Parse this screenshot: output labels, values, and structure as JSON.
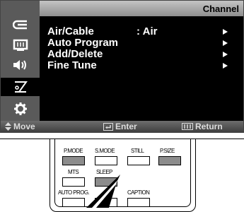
{
  "osd": {
    "title": "Channel",
    "sidebar_icons": [
      "input-icon",
      "picture-icon",
      "sound-icon",
      "channel-antenna-icon",
      "setup-gear-icon"
    ],
    "selected_icon_index": 3,
    "menu": [
      {
        "label": "Air/Cable",
        "value": ": Air",
        "has_arrow": true,
        "selected": true
      },
      {
        "label": "Auto Program",
        "value": "",
        "has_arrow": true,
        "selected": false
      },
      {
        "label": "Add/Delete",
        "value": "",
        "has_arrow": true,
        "selected": false
      },
      {
        "label": "Fine Tune",
        "value": "",
        "has_arrow": true,
        "selected": false
      }
    ],
    "footer": {
      "move": "Move",
      "enter": "Enter",
      "return": "Return"
    }
  },
  "remote": {
    "row1": [
      "P.MODE",
      "S.MODE",
      "STILL",
      "P.SIZE"
    ],
    "row2": [
      "MTS",
      "SLEEP"
    ],
    "row3": [
      "AUTO PROG.",
      "CAPTION"
    ],
    "highlighted_buttons": [
      "P.MODE",
      "P.SIZE",
      "SLEEP"
    ]
  }
}
